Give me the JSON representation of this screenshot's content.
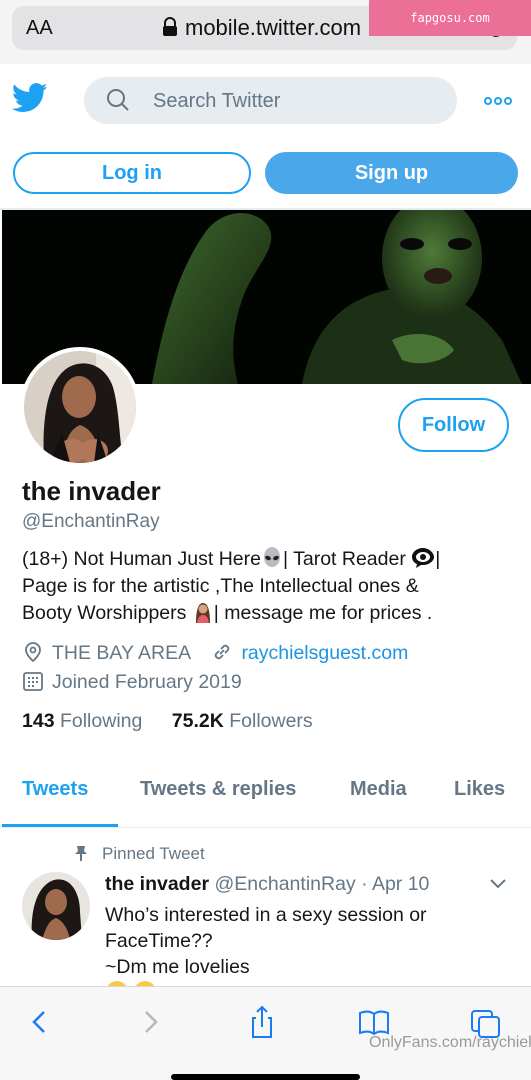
{
  "browser": {
    "text_size_label": "AA",
    "url": "mobile.twitter.com",
    "watermark": "fapgosu.com"
  },
  "header": {
    "search_placeholder": "Search Twitter",
    "login_label": "Log in",
    "signup_label": "Sign up"
  },
  "profile": {
    "follow_label": "Follow",
    "name": "the invader",
    "handle": "@EnchantinRay",
    "bio_line1_a": "(18+) Not Human Just Here",
    "bio_line1_b": "| Tarot Reader ",
    "bio_line1_c": "|",
    "bio_line2": "Page is for the artistic ,The Intellectual ones &",
    "bio_line3_a": "Booty Worshippers ",
    "bio_line3_b": "| message me for prices .",
    "location": "THE BAY AREA",
    "website": "raychielsguest.com",
    "joined": "Joined February 2019",
    "following_count": "143",
    "following_label": "Following",
    "followers_count": "75.2K",
    "followers_label": "Followers"
  },
  "tabs": [
    {
      "label": "Tweets",
      "active": true
    },
    {
      "label": "Tweets & replies",
      "active": false
    },
    {
      "label": "Media",
      "active": false
    },
    {
      "label": "Likes",
      "active": false
    }
  ],
  "tweet": {
    "pinned_label": "Pinned Tweet",
    "name": "the invader",
    "handle": "@EnchantinRay",
    "separator": "·",
    "date": "Apr 10",
    "line1": "Who’s interested in a sexy session or",
    "line2": "FaceTime??",
    "line3": "~Dm me lovelies "
  },
  "footer": {
    "source_mark": "OnlyFans.com/raychiel"
  },
  "colors": {
    "twitter_blue": "#1da1f2",
    "muted_gray": "#657786",
    "search_bg": "#e6ecf0"
  },
  "icons": [
    "lock-icon",
    "reload-icon",
    "twitter-bird-icon",
    "search-icon",
    "more-icon",
    "location-icon",
    "link-icon",
    "calendar-icon",
    "pin-icon",
    "chevron-down-icon",
    "back-icon",
    "forward-icon",
    "share-icon",
    "bookmarks-icon",
    "tabs-icon"
  ]
}
